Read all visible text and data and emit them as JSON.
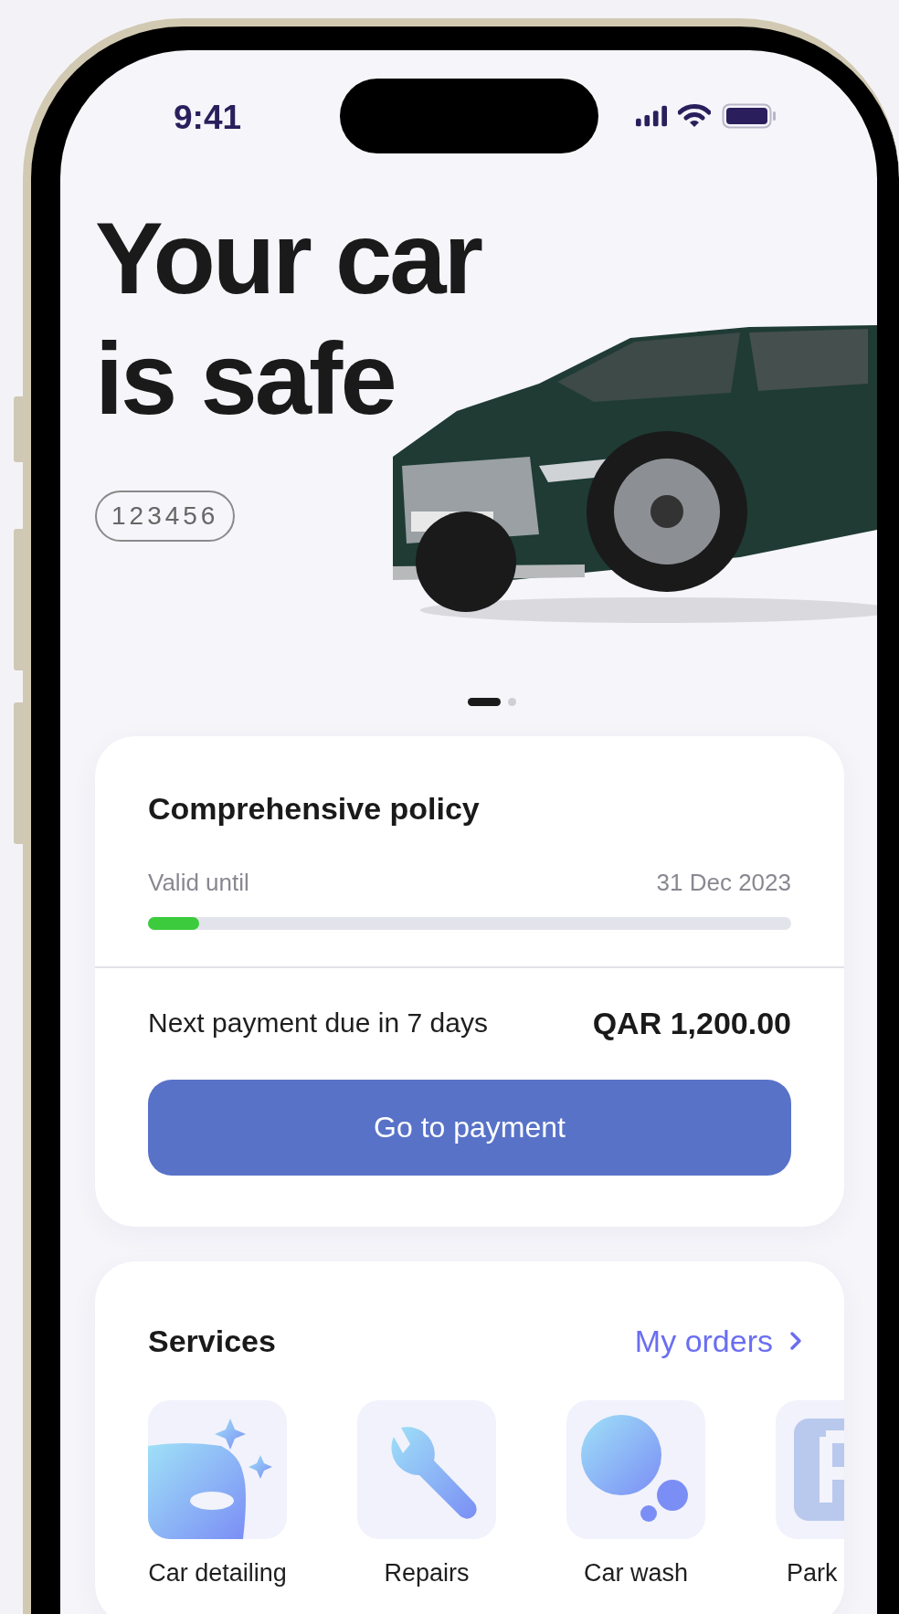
{
  "status_bar": {
    "time": "9:41"
  },
  "hero": {
    "title_lines": [
      "Your car",
      "is safe"
    ],
    "plate": "123456"
  },
  "carousel": {
    "pages": [
      {
        "selected": true
      },
      {
        "selected": false
      }
    ]
  },
  "policy_card": {
    "title": "Comprehensive policy",
    "valid_label": "Valid until",
    "valid_date": "31 Dec 2023",
    "level": 0.08,
    "payment_note": "Next payment due in 7 days",
    "amount": "QAR 1,200.00",
    "button": "Go to payment"
  },
  "services": {
    "title": "Services",
    "link": "My orders",
    "items": [
      {
        "kind": "detailing",
        "label": "Car detailing"
      },
      {
        "kind": "repairs",
        "label": "Repairs"
      },
      {
        "kind": "wash",
        "label": "Car wash"
      },
      {
        "kind": "parking",
        "label": "Park"
      }
    ]
  }
}
